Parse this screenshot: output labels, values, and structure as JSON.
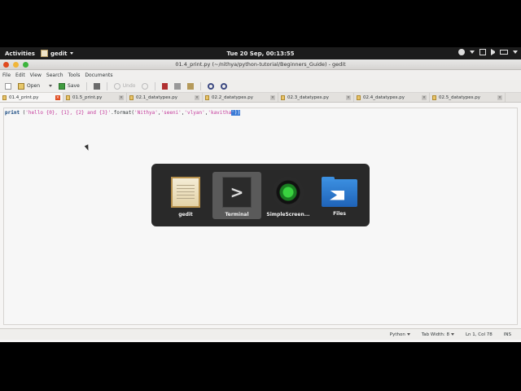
{
  "topbar": {
    "activities": "Activities",
    "app_menu": "gedit",
    "clock": "Tue 20 Sep, 00:13:55"
  },
  "window": {
    "title": "01.4_print.py (~/nithya/python-tutorial/Beginners_Guide) - gedit"
  },
  "menubar": {
    "items": [
      "File",
      "Edit",
      "View",
      "Search",
      "Tools",
      "Documents"
    ]
  },
  "toolbar": {
    "open_label": "Open",
    "save_label": "Save",
    "undo_label": "Undo"
  },
  "tabs": [
    {
      "label": "01.4_print.py"
    },
    {
      "label": "01.5_print.py"
    },
    {
      "label": "02.1_datatypes.py"
    },
    {
      "label": "02.2_datatypes.py"
    },
    {
      "label": "02.3_datatypes.py"
    },
    {
      "label": "02.4_datatypes.py"
    },
    {
      "label": "02.5_datatypes.py"
    }
  ],
  "editor": {
    "line1": {
      "kw": "print",
      "p1": " (",
      "s1": "'hello {0}, {1}, {2} and {3}'",
      "p2": ".format(",
      "s2": "'Nithya'",
      "c1": ",",
      "s3": "'seeni'",
      "c2": ",",
      "s4": "'vlyan'",
      "c3": ",",
      "s5": "'kavitha",
      "sel": "'))"
    }
  },
  "statusbar": {
    "language": "Python",
    "tab_width": "Tab Width: 8",
    "position": "Ln 1, Col 78",
    "mode": "INS"
  },
  "switcher": {
    "items": [
      {
        "label": "gedit",
        "icon": "gedit-icon"
      },
      {
        "label": "Terminal",
        "icon": "terminal-icon"
      },
      {
        "label": "SimpleScreen...",
        "icon": "simplescreenrecorder-icon"
      },
      {
        "label": "Files",
        "icon": "files-icon"
      }
    ],
    "selected": "Terminal"
  }
}
